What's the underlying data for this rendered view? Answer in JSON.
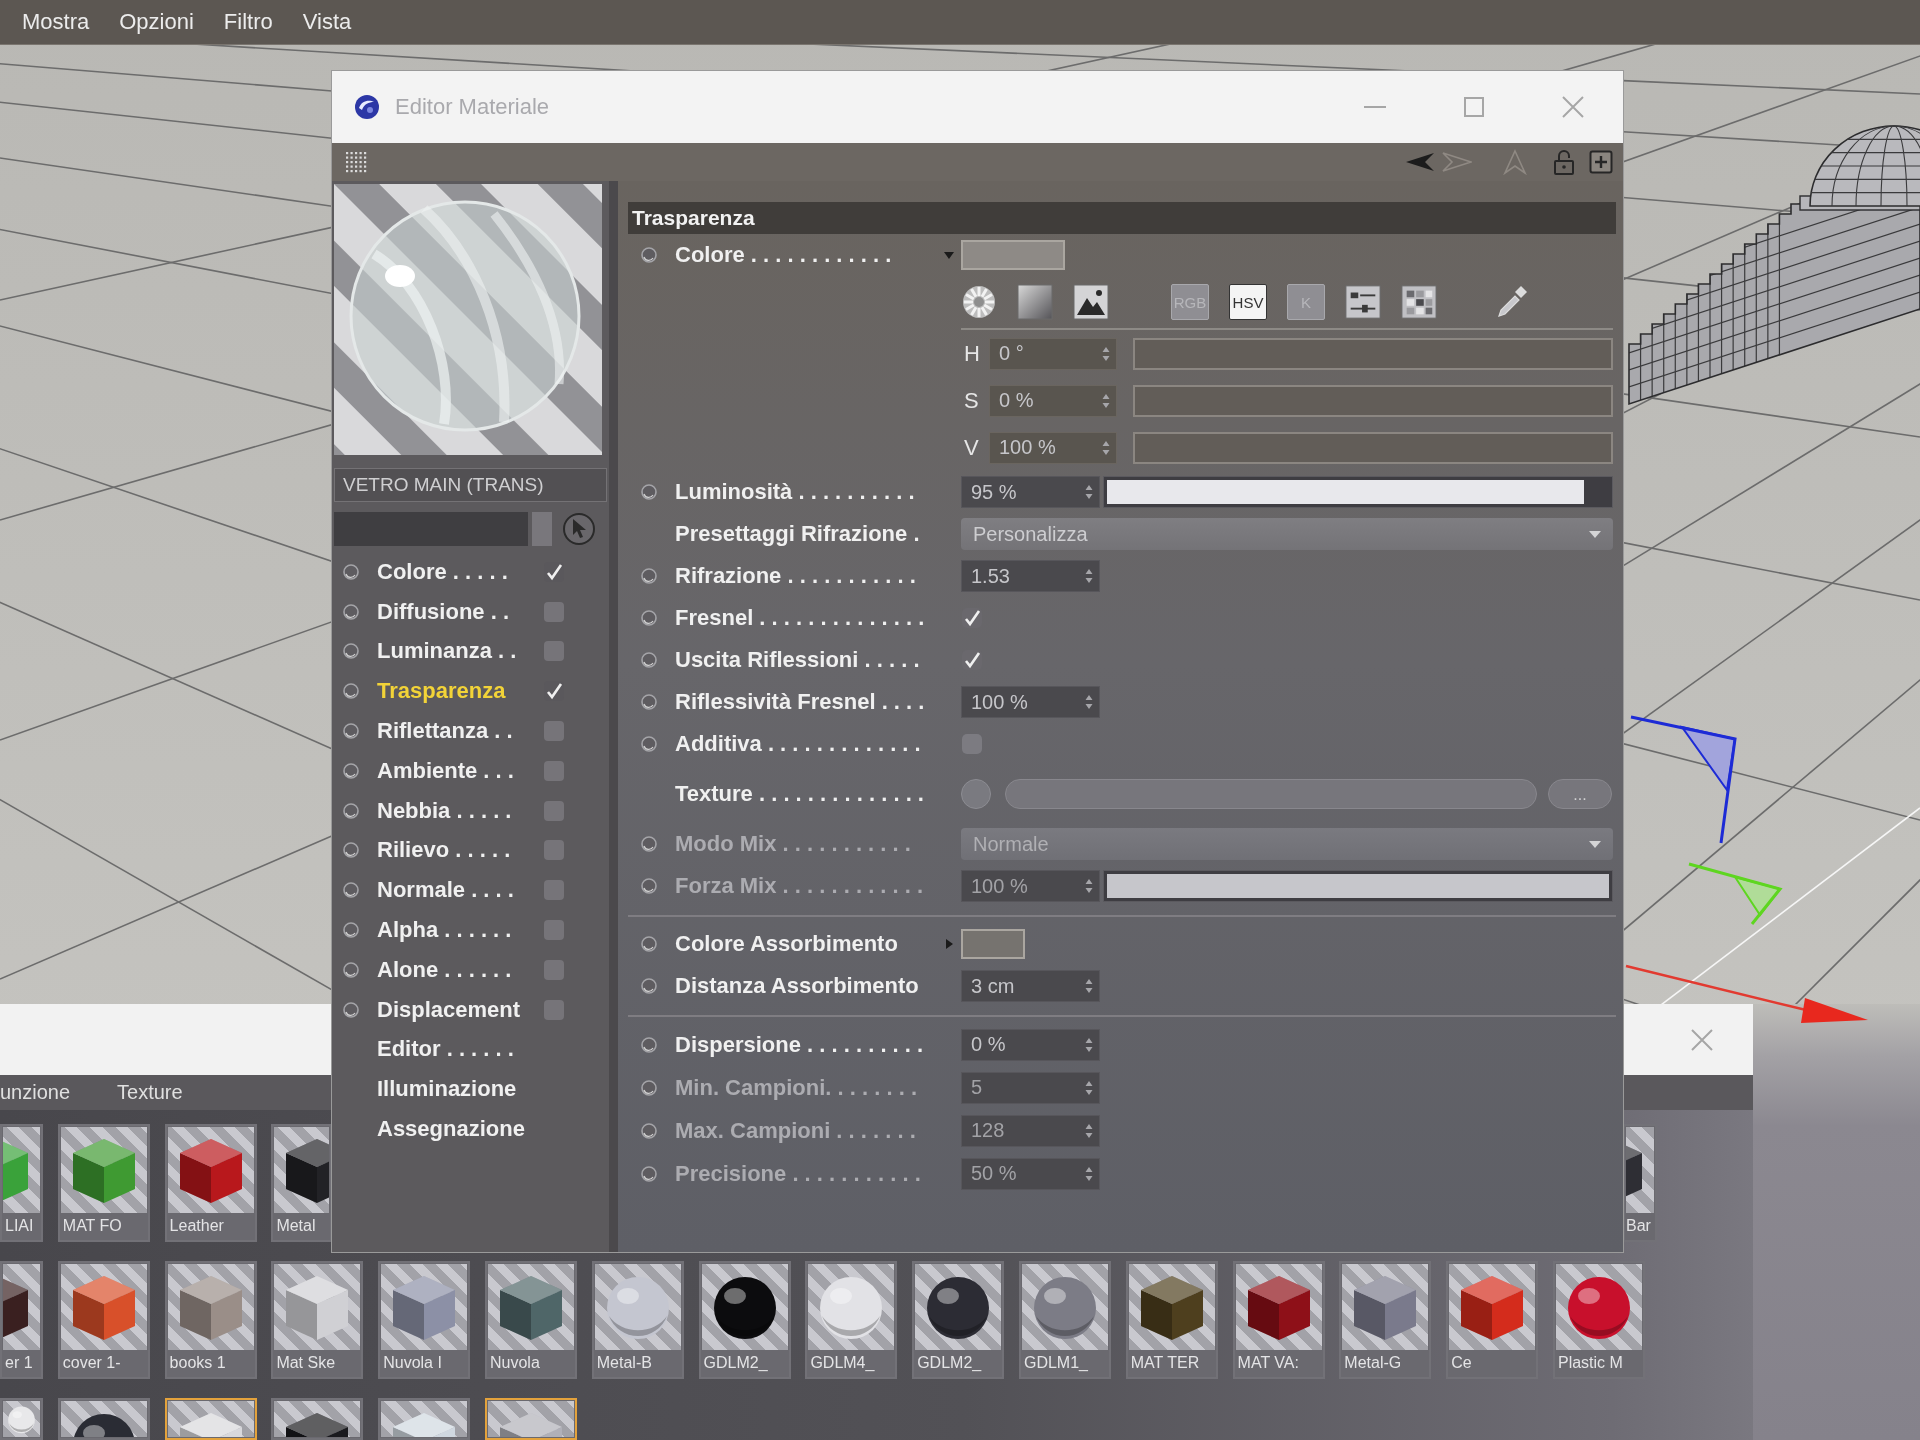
{
  "menu_bar": {
    "items": [
      "Mostra",
      "Opzioni",
      "Filtro",
      "Vista"
    ]
  },
  "editor": {
    "title": "Editor Materiale",
    "material_name": "VETRO MAIN (TRANS)",
    "channels": [
      {
        "label": "Colore . . . . .",
        "kind": "channel",
        "checked": true,
        "selected": false
      },
      {
        "label": "Diffusione . .",
        "kind": "channel",
        "checked": false,
        "selected": false
      },
      {
        "label": "Luminanza . .",
        "kind": "channel",
        "checked": false,
        "selected": false
      },
      {
        "label": "Trasparenza",
        "kind": "channel",
        "checked": true,
        "selected": true
      },
      {
        "label": "Riflettanza . .",
        "kind": "channel",
        "checked": false,
        "selected": false
      },
      {
        "label": "Ambiente . . .",
        "kind": "channel",
        "checked": false,
        "selected": false
      },
      {
        "label": "Nebbia . . . . .",
        "kind": "channel",
        "checked": false,
        "selected": false
      },
      {
        "label": "Rilievo . . . . .",
        "kind": "channel",
        "checked": false,
        "selected": false
      },
      {
        "label": "Normale . . . .",
        "kind": "channel",
        "checked": false,
        "selected": false
      },
      {
        "label": "Alpha . . . . . .",
        "kind": "channel",
        "checked": false,
        "selected": false
      },
      {
        "label": "Alone . . . . . .",
        "kind": "channel",
        "checked": false,
        "selected": false
      },
      {
        "label": "Displacement",
        "kind": "channel",
        "checked": false,
        "selected": false
      },
      {
        "label": "Editor . . . . . .",
        "kind": "page",
        "selected": false
      },
      {
        "label": "Illuminazione",
        "kind": "page",
        "selected": false
      },
      {
        "label": "Assegnazione",
        "kind": "page",
        "selected": false
      }
    ],
    "section": {
      "title": "Trasparenza",
      "groups": [
        {
          "rows": [
            {
              "kind": "color",
              "label": "Colore . . . . . . . . . . . .",
              "animatable": true,
              "disabled": false,
              "expanded": true,
              "color": "#8e8a86",
              "modes": [
                {
                  "label": "RGB",
                  "selected": false
                },
                {
                  "label": "HSV",
                  "selected": true
                },
                {
                  "label": "K",
                  "selected": false
                }
              ],
              "components": [
                {
                  "letter": "H",
                  "value": "0 °"
                },
                {
                  "letter": "S",
                  "value": "0 %"
                },
                {
                  "letter": "V",
                  "value": "100 %"
                }
              ]
            },
            {
              "kind": "slider",
              "label": "Luminosità . . . . . . . . . .",
              "animatable": true,
              "disabled": false,
              "value": "95 %",
              "level": 0.95
            },
            {
              "kind": "dropdown",
              "label": "Presettaggi Rifrazione .",
              "animatable": false,
              "disabled": false,
              "value": "Personalizza"
            },
            {
              "kind": "number",
              "label": "Rifrazione . . . . . . . . . . .",
              "animatable": true,
              "disabled": false,
              "value": "1.53"
            },
            {
              "kind": "checkbox",
              "label": "Fresnel . . . . . . . . . . . . . .",
              "animatable": true,
              "disabled": false,
              "checked": true
            },
            {
              "kind": "checkbox",
              "label": "Uscita Riflessioni . . . . .",
              "animatable": true,
              "disabled": false,
              "checked": true
            },
            {
              "kind": "number",
              "label": "Riflessività Fresnel . . . .",
              "animatable": true,
              "disabled": false,
              "value": "100 %"
            },
            {
              "kind": "checkbox",
              "label": "Additiva . . . . . . . . . . . . .",
              "animatable": true,
              "disabled": false,
              "checked": false
            },
            {
              "kind": "texture",
              "label": "Texture . . . . . . . . . . . . . .",
              "animatable": false,
              "disabled": false,
              "button": "..."
            },
            {
              "kind": "dropdown",
              "label": "Modo Mix . . . . . . . . . . .",
              "animatable": true,
              "disabled": true,
              "value": "Normale"
            },
            {
              "kind": "slider",
              "label": "Forza Mix . . . . . . . . . . . .",
              "animatable": true,
              "disabled": true,
              "value": "100 %",
              "level": 1
            }
          ]
        },
        {
          "rows": [
            {
              "kind": "color",
              "label": "Colore Assorbimento",
              "animatable": true,
              "disabled": false,
              "expanded": false,
              "color": "#76736f"
            },
            {
              "kind": "number",
              "label": "Distanza Assorbimento",
              "animatable": true,
              "disabled": false,
              "value": "3 cm"
            }
          ]
        },
        {
          "rows": [
            {
              "kind": "number",
              "label": "Dispersione . . . . . . . . . .",
              "animatable": true,
              "disabled": false,
              "value": "0 %"
            },
            {
              "kind": "number",
              "label": "Min. Campioni. . . . . . . .",
              "animatable": true,
              "disabled": true,
              "value": "5"
            },
            {
              "kind": "number",
              "label": "Max. Campioni . . . . . . .",
              "animatable": true,
              "disabled": true,
              "value": "128"
            },
            {
              "kind": "number",
              "label": "Precisione . . . . . . . . . . .",
              "animatable": true,
              "disabled": true,
              "value": "50 %"
            }
          ]
        }
      ]
    }
  },
  "material_manager": {
    "menu": [
      "unzione",
      "Texture"
    ],
    "rows": [
      {
        "items": [
          {
            "label": "LIAI",
            "kind": "cube",
            "color": "#3aa23a",
            "selected": false
          },
          {
            "label": "MAT FO",
            "kind": "cube",
            "color": "#3f9a32",
            "selected": false
          },
          {
            "label": "Leather",
            "kind": "cube",
            "color": "#b8181c",
            "selected": false
          },
          {
            "label": "Metal",
            "kind": "cube",
            "color": "#222226",
            "selected": false
          }
        ],
        "beside_editor": [
          {
            "label": "Bar",
            "kind": "cube",
            "color": "#2e2e34",
            "selected": false
          }
        ]
      },
      {
        "items": [
          {
            "label": "er 1",
            "kind": "cube",
            "color": "#3a2020",
            "selected": false
          },
          {
            "label": "cover 1-",
            "kind": "cube",
            "color": "#d8502a",
            "selected": false
          },
          {
            "label": "books 1",
            "kind": "cube",
            "color": "#9a8e88",
            "selected": false
          },
          {
            "label": "Mat Ske",
            "kind": "cube",
            "color": "#d0d0d4",
            "selected": false
          },
          {
            "label": "Nuvola I",
            "kind": "cube",
            "color": "#8c90a6",
            "selected": false
          },
          {
            "label": "Nuvola",
            "kind": "cube",
            "color": "#4f6668",
            "selected": false
          },
          {
            "label": "Metal-B",
            "kind": "sphere",
            "color": "#c4c6d0",
            "selected": false
          },
          {
            "label": "GDLM2_",
            "kind": "sphere",
            "color": "#0c0c0e",
            "selected": false
          },
          {
            "label": "GDLM4_",
            "kind": "sphere",
            "color": "#e2e2e6",
            "selected": false
          },
          {
            "label": "GDLM2_",
            "kind": "sphere",
            "color": "#2c2c34",
            "selected": false
          },
          {
            "label": "GDLM1_",
            "kind": "sphere",
            "color": "#7c7c86",
            "selected": false
          },
          {
            "label": "MAT TER",
            "kind": "cube",
            "color": "#4e3f1e",
            "selected": false
          },
          {
            "label": "MAT VA:",
            "kind": "cube",
            "color": "#8e1018",
            "selected": false
          },
          {
            "label": "Metal-G",
            "kind": "cube",
            "color": "#7a7a8c",
            "selected": false
          },
          {
            "label": "Ce",
            "kind": "cube",
            "color": "#d42c1c",
            "selected": false
          },
          {
            "label": "Plastic M",
            "kind": "sphere",
            "color": "#c8102c",
            "selected": false
          }
        ]
      },
      {
        "items": [
          {
            "kind": "sphere",
            "color": "#e8e8ea",
            "selected": false
          },
          {
            "kind": "sphere",
            "color": "#2a2c34",
            "selected": false
          },
          {
            "kind": "cube",
            "color": "#d8d8dc",
            "selected": true
          },
          {
            "kind": "cube",
            "color": "#1a1a1e",
            "selected": false
          },
          {
            "kind": "cube",
            "color": "#d0d8e0",
            "selected": false
          },
          {
            "kind": "cube",
            "color": "#b0b0b8",
            "selected": true
          }
        ]
      }
    ]
  }
}
